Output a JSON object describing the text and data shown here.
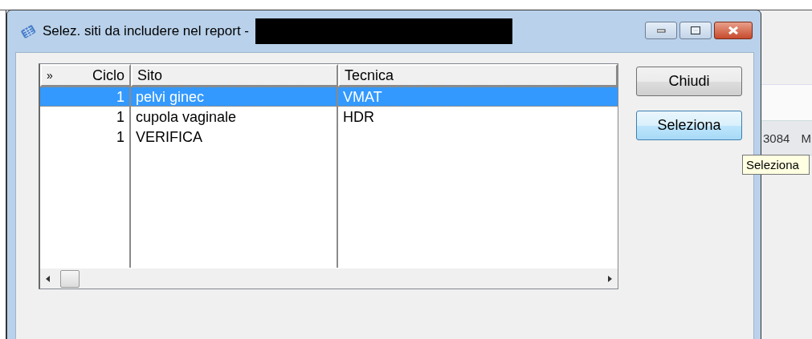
{
  "dialog": {
    "title": "Selez. siti da includere nel report -",
    "columns": [
      {
        "label": "Ciclo",
        "marker": "»"
      },
      {
        "label": "Sito"
      },
      {
        "label": "Tecnica"
      }
    ],
    "rows": [
      {
        "cells": [
          "1",
          "pelvi ginec",
          "VMAT"
        ],
        "selected": true
      },
      {
        "cells": [
          "1",
          "cupola vaginale",
          "HDR"
        ],
        "selected": false
      },
      {
        "cells": [
          "1",
          "VERIFICA"
        ],
        "selected": false
      }
    ],
    "buttons": [
      {
        "label": "Chiudi",
        "hovered": false
      },
      {
        "label": "Seleziona",
        "hovered": true
      }
    ]
  },
  "background_window": {
    "texts": [
      "3084",
      "M"
    ]
  },
  "tooltip": "Seleziona"
}
